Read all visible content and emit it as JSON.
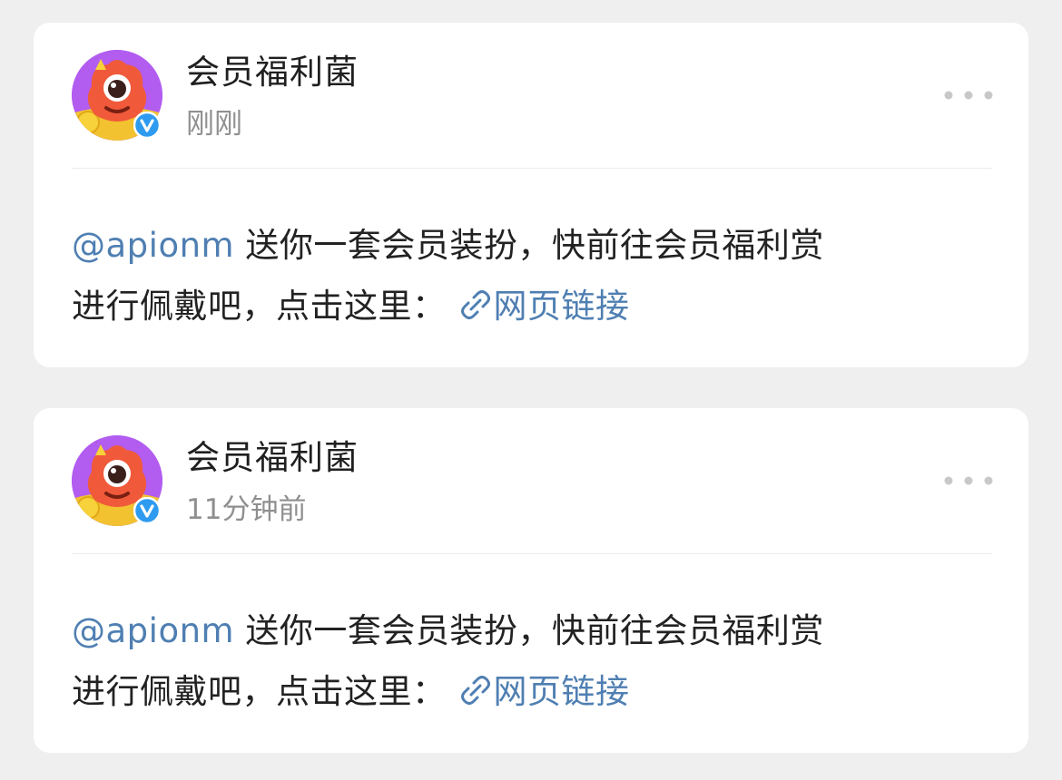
{
  "colors": {
    "background": "#efefef",
    "card": "#ffffff",
    "mention": "#4f7fb2",
    "link": "#4f7fb2",
    "verified_badge": "#2f9bf0"
  },
  "posts": [
    {
      "username": "会员福利菌",
      "timestamp": "刚刚",
      "avatar_icon": "red-monster-avatar-icon",
      "verified_icon": "verified-v-icon",
      "more_icon": "more-dots-icon",
      "mention": "@apionm",
      "line1": " 送你一套会员装扮，快前往会员福利赏",
      "line2": "进行佩戴吧，点击这里：",
      "link_icon": "link-chain-icon",
      "link_text": "网页链接"
    },
    {
      "username": "会员福利菌",
      "timestamp": "11分钟前",
      "avatar_icon": "red-monster-avatar-icon",
      "verified_icon": "verified-v-icon",
      "more_icon": "more-dots-icon",
      "mention": "@apionm",
      "line1": " 送你一套会员装扮，快前往会员福利赏",
      "line2": "进行佩戴吧，点击这里：",
      "link_icon": "link-chain-icon",
      "link_text": "网页链接"
    }
  ]
}
